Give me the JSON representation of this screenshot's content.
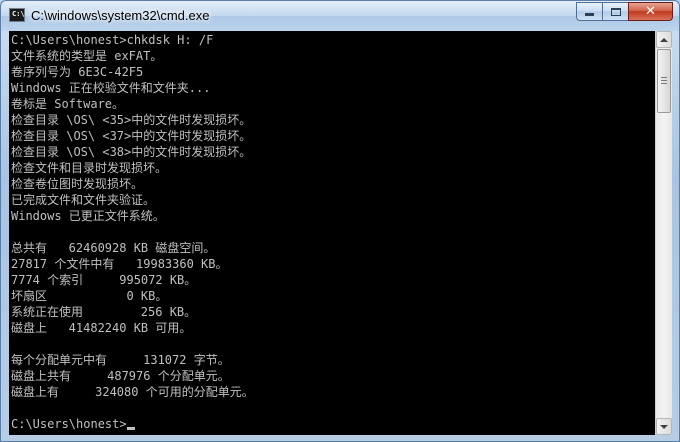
{
  "window": {
    "title": "C:\\windows\\system32\\cmd.exe",
    "icon_label": "C:\\"
  },
  "controls": {
    "minimize_icon": "minimize-icon",
    "maximize_icon": "maximize-icon",
    "close_icon": "close-icon"
  },
  "console": {
    "lines": [
      "C:\\Users\\honest>chkdsk H: /F",
      "文件系统的类型是 exFAT。",
      "卷序列号为 6E3C-42F5",
      "Windows 正在校验文件和文件夹...",
      "卷标是 Software。",
      "检查目录 \\OS\\ <35>中的文件时发现损坏。",
      "检查目录 \\OS\\ <37>中的文件时发现损坏。",
      "检查目录 \\OS\\ <38>中的文件时发现损坏。",
      "检查文件和目录时发现损坏。",
      "检查卷位图时发现损坏。",
      "已完成文件和文件夹验证。",
      "Windows 已更正文件系统。",
      "",
      "总共有   62460928 KB 磁盘空间。",
      "27817 个文件中有   19983360 KB。",
      "7774 个索引     995072 KB。",
      "坏扇区           0 KB。",
      "系统正在使用        256 KB。",
      "磁盘上   41482240 KB 可用。",
      "",
      "每个分配单元中有     131072 字节。",
      "磁盘上共有     487976 个分配单元。",
      "磁盘上有     324080 个可用的分配单元。",
      "",
      "C:\\Users\\honest>"
    ]
  },
  "colors": {
    "console_bg": "#000000",
    "console_fg": "#c0c0c0"
  }
}
